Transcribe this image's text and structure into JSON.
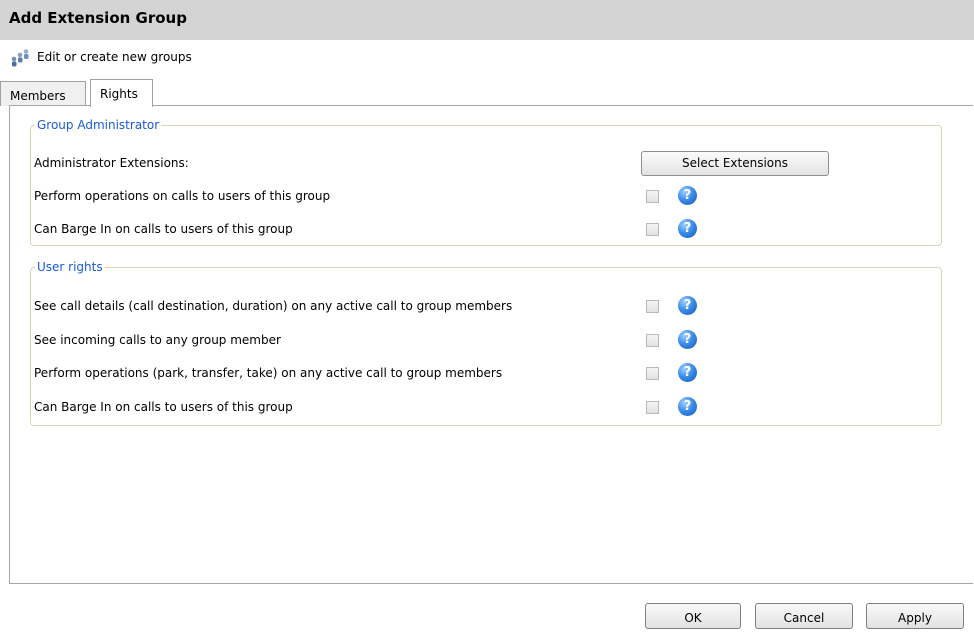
{
  "window": {
    "title": "Add Extension Group"
  },
  "subtitle": {
    "text": "Edit or create new groups",
    "icon": "group-users-icon"
  },
  "tabs": [
    {
      "label": "Members",
      "active": false
    },
    {
      "label": "Rights",
      "active": true
    }
  ],
  "group_admin": {
    "legend": "Group Administrator",
    "admin_extensions_label": "Administrator Extensions:",
    "select_button_label": "Select Extensions",
    "options": [
      {
        "label": "Perform operations on calls to users of this group",
        "checked": false
      },
      {
        "label": "Can Barge In on calls to users of this group",
        "checked": false
      }
    ]
  },
  "user_rights": {
    "legend": "User rights",
    "options": [
      {
        "label": "See call details (call destination, duration) on any active call to group members",
        "checked": false
      },
      {
        "label": "See incoming calls to any group member",
        "checked": false
      },
      {
        "label": "Perform operations (park, transfer, take) on any active call to group members",
        "checked": false
      },
      {
        "label": "Can Barge In on calls to users of this group",
        "checked": false
      }
    ]
  },
  "help_glyph": "?",
  "footer": {
    "ok_label": "OK",
    "cancel_label": "Cancel",
    "apply_label": "Apply"
  },
  "colors": {
    "title_bar": "#d4d4d4",
    "legend_text": "#1a5bd8",
    "help_icon": "#3c8ee8"
  }
}
